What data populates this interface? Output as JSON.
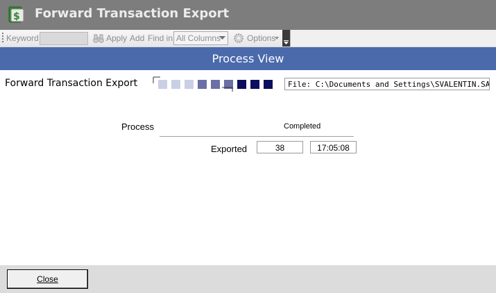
{
  "window": {
    "title": "Forward Transaction Export",
    "app_icon": "sage-dollar-icon"
  },
  "toolbar": {
    "keyword_label": "Keyword",
    "keyword_value": "",
    "apply_label": "Apply",
    "add_label": "Add",
    "find_in_label": "Find in",
    "find_in_selected": "All Columns",
    "options_label": "Options"
  },
  "header": {
    "title": "Process View"
  },
  "process": {
    "name": "Forward Transaction Export",
    "file_path": "File: C:\\Documents and Settings\\SVALENTIN.SAGE",
    "progress_segments": [
      "#c9d0e5",
      "#c9d0e5",
      "#c9d0e5",
      "#6b6fa6",
      "#6b6fa6",
      "#6b6fa6",
      "#0b0f5e",
      "#0b0f5e",
      "#0b0f5e"
    ]
  },
  "status": {
    "process_label": "Process",
    "status_value": "Completed",
    "exported_label": "Exported",
    "exported_count": "38",
    "exported_time": "17:05:08"
  },
  "footer": {
    "close_label": "Close"
  },
  "colors": {
    "titlebar": "#7d7d7d",
    "header_band": "#4a6aac",
    "footer": "#dcdcdc"
  }
}
